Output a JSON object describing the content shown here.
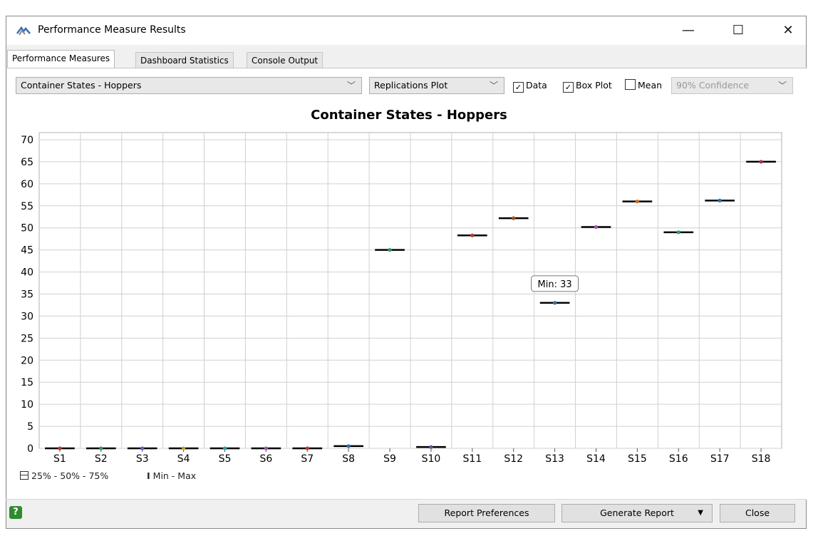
{
  "window": {
    "title": "Performance Measure Results",
    "minimize": "—",
    "maximize": "☐",
    "close": "✕"
  },
  "tabs": [
    "Performance Measures",
    "Dashboard Statistics",
    "Console Output"
  ],
  "toolbar": {
    "measure_select": "Container States - Hoppers",
    "plot_select": "Replications Plot",
    "data_label": "Data",
    "data_checked": true,
    "boxplot_label": "Box Plot",
    "boxplot_checked": true,
    "mean_label": "Mean",
    "mean_checked": false,
    "confidence_select": "90% Confidence"
  },
  "legend": {
    "box": "25% - 50% - 75%",
    "minmax": "Min - Max"
  },
  "tooltip": {
    "text": "Min: 33"
  },
  "buttons": {
    "report_preferences": "Report Preferences",
    "generate_report": "Generate Report",
    "close": "Close"
  },
  "chart_data": {
    "type": "scatter",
    "title": "Container States - Hoppers",
    "categories": [
      "S1",
      "S2",
      "S3",
      "S4",
      "S5",
      "S6",
      "S7",
      "S8",
      "S9",
      "S10",
      "S11",
      "S12",
      "S13",
      "S14",
      "S15",
      "S16",
      "S17",
      "S18"
    ],
    "values": [
      0,
      0,
      0,
      0,
      0,
      0,
      0,
      0.5,
      45,
      0.3,
      48.3,
      52.2,
      33,
      50.2,
      56,
      49,
      56.2,
      65
    ],
    "point_colors": [
      "#c0392b",
      "#2e9e5b",
      "#6a5acd",
      "#c8a02a",
      "#2aa5a5",
      "#b04fc0",
      "#c0392b",
      "#2e6fa8",
      "#2e9e5b",
      "#7a4aa0",
      "#c0392b",
      "#a0522d",
      "#2e6fa8",
      "#b04fc0",
      "#c8702a",
      "#2e9e5b",
      "#2e6fa8",
      "#a0306a"
    ],
    "ylim": [
      0,
      70
    ],
    "yticks": [
      0,
      5,
      10,
      15,
      20,
      25,
      30,
      35,
      40,
      45,
      50,
      55,
      60,
      65,
      70
    ],
    "grid": true
  }
}
